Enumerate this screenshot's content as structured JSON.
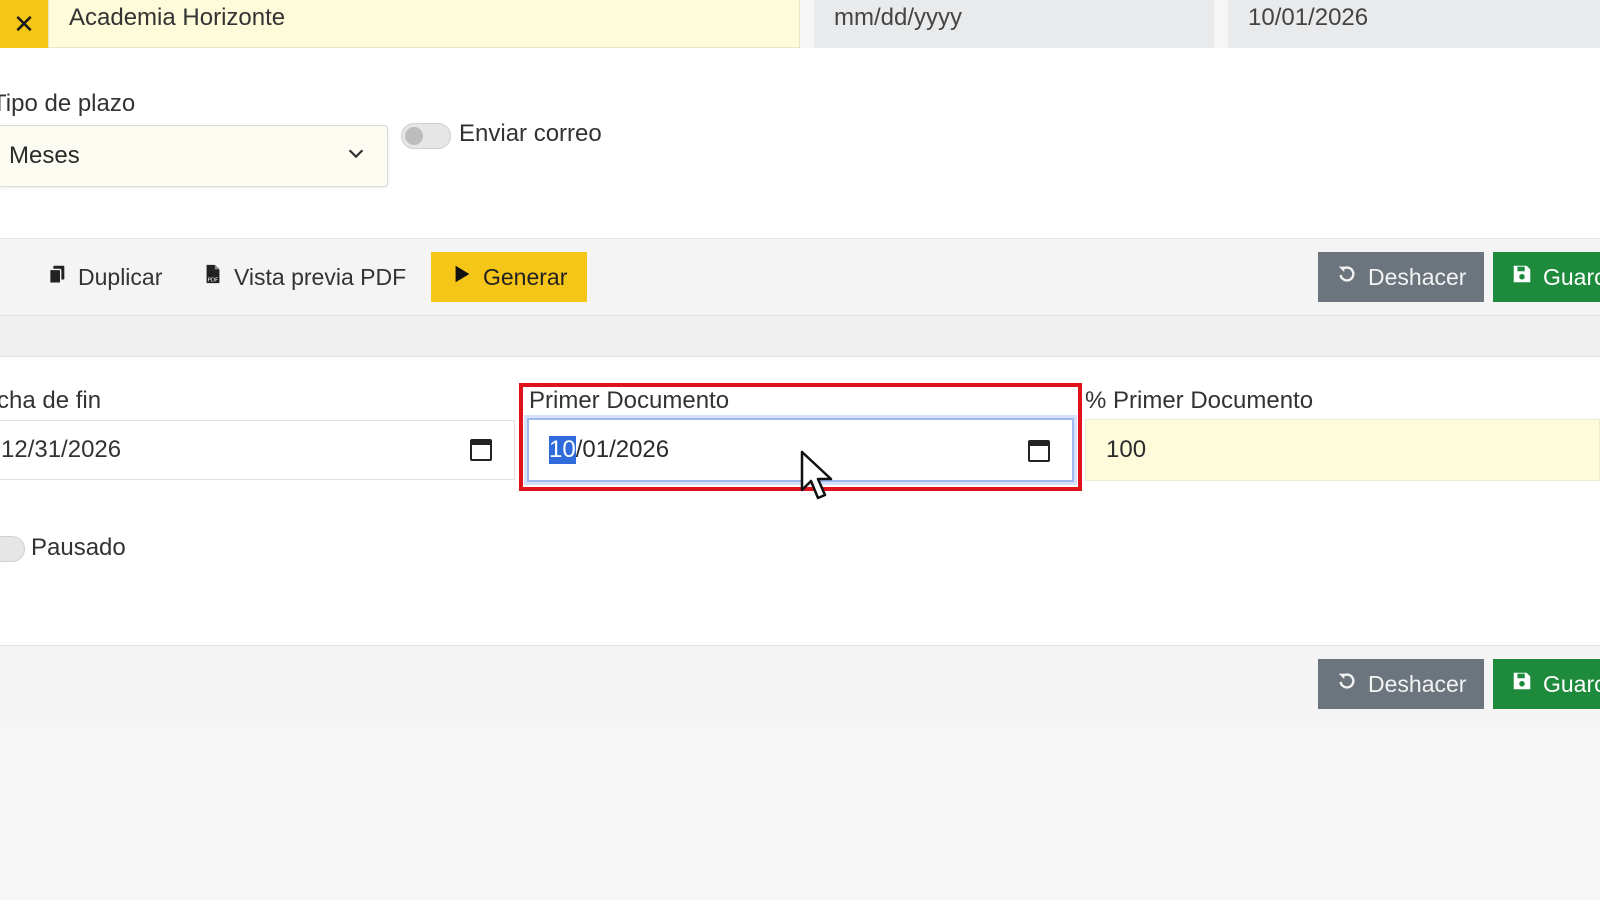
{
  "top": {
    "close_icon": "close-icon",
    "client_value": "Academia Horizonte",
    "date_start_value": "mm/dd/yyyy",
    "date_right_value": "10/01/2026"
  },
  "plazo": {
    "label": "Tipo de plazo",
    "selected": "Meses",
    "chevron_icon": "chevron-down-icon"
  },
  "email_toggle": {
    "label": "Enviar correo",
    "on": false
  },
  "toolbar": {
    "duplicate_label": "Duplicar",
    "preview_label": "Vista previa PDF",
    "generate_label": "Generar",
    "undo_label": "Deshacer",
    "save_label": "Guarc"
  },
  "fields": {
    "end_date_label": "cha de fin",
    "end_date_value": "12/31/2026",
    "first_doc_label": "Primer Documento",
    "first_doc_selected": "10",
    "first_doc_rest": "/01/2026",
    "pct_label": "% Primer Documento",
    "pct_value": "100"
  },
  "paused_toggle": {
    "label": "Pausado",
    "on": false
  },
  "bottom": {
    "undo_label": "Deshacer",
    "save_label": "Guarc"
  },
  "colors": {
    "accent_yellow": "#f5c518",
    "save_green": "#1e8a3c",
    "undo_gray": "#6c757d",
    "highlight_red": "#e0131d"
  }
}
